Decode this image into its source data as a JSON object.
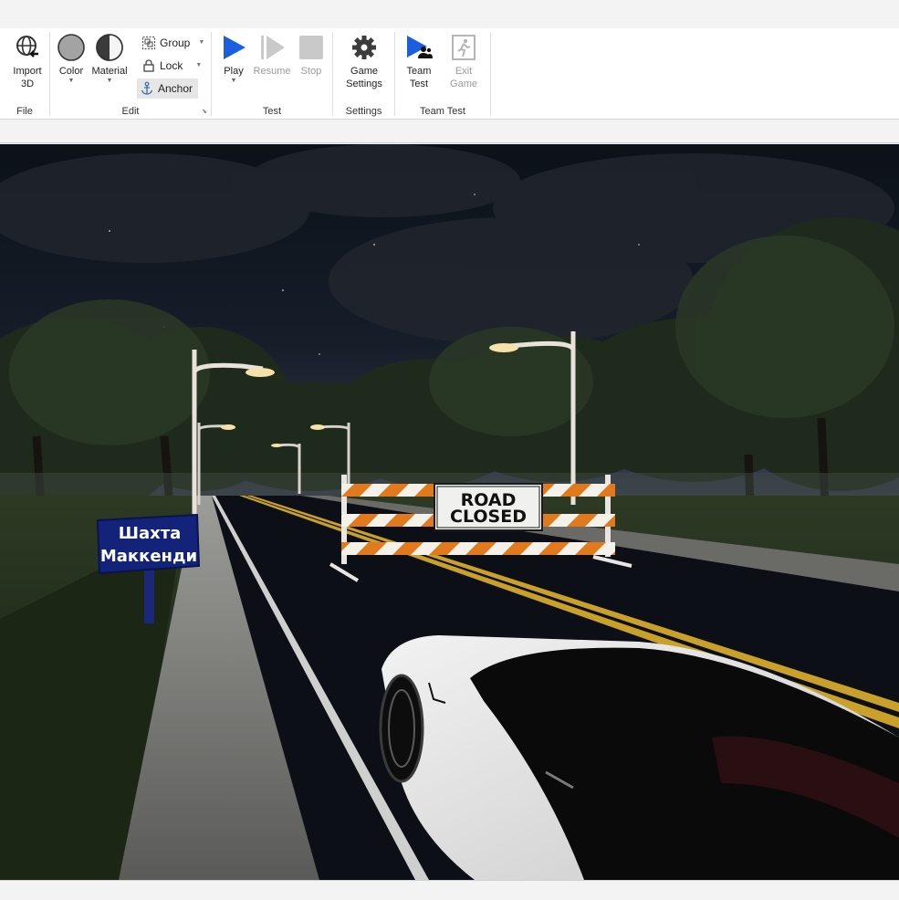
{
  "ribbon": {
    "file": {
      "label": "File",
      "import3d_label": "Import\n3D"
    },
    "edit": {
      "label": "Edit",
      "color_label": "Color",
      "material_label": "Material",
      "group_label": "Group",
      "lock_label": "Lock",
      "anchor_label": "Anchor"
    },
    "test": {
      "label": "Test",
      "play_label": "Play",
      "resume_label": "Resume",
      "stop_label": "Stop"
    },
    "settings": {
      "label": "Settings",
      "game_settings_label": "Game\nSettings"
    },
    "team_test": {
      "label": "Team Test",
      "team_test_label": "Team\nTest",
      "exit_game_label": "Exit\nGame"
    }
  },
  "scene": {
    "mine_sign_line1": "Шахта",
    "mine_sign_line2": "Маккенди",
    "road_sign_line1": "ROAD",
    "road_sign_line2": "CLOSED"
  },
  "colors": {
    "accent_blue": "#1a5fe0",
    "sign_blue": "#13237a",
    "barrier_orange": "#e07a1c"
  }
}
